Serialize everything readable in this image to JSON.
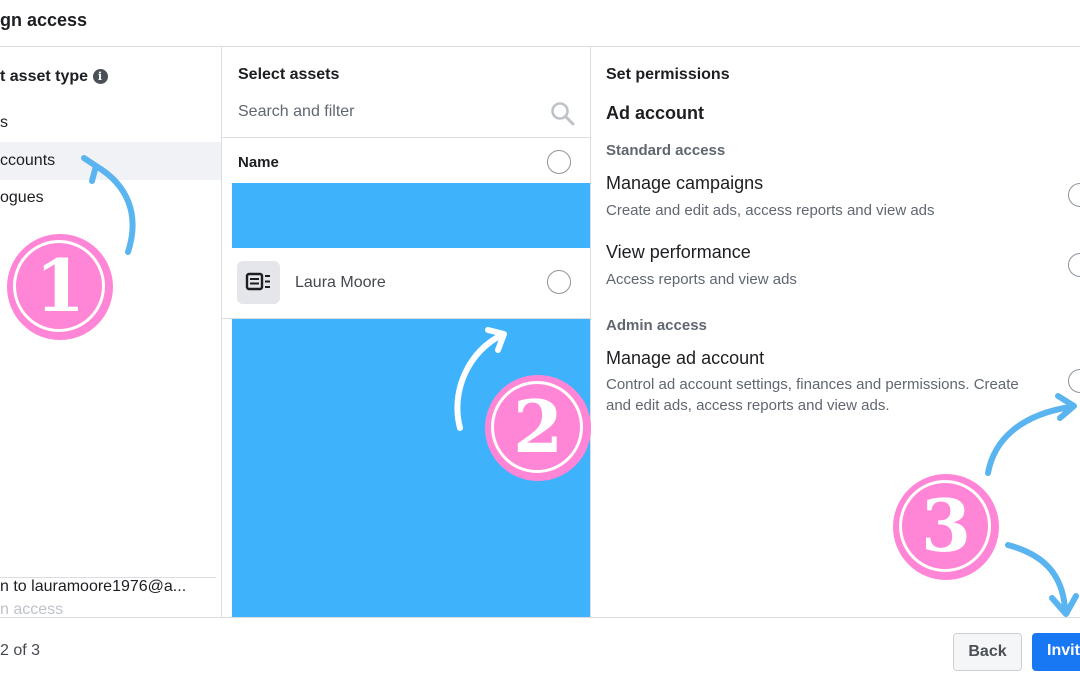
{
  "dialog": {
    "title": "gn access"
  },
  "asset_types": {
    "heading": "t asset type",
    "info_icon": "info-icon",
    "items": [
      {
        "label": "s"
      },
      {
        "label": "ccounts"
      },
      {
        "label": "ogues"
      }
    ],
    "share_text": "n to lauramoore1976@a...",
    "share_subtext": "n access"
  },
  "assets": {
    "heading": "Select assets",
    "search_placeholder": "Search and filter",
    "column_name": "Name",
    "rows": [
      {
        "label": "Laura Moore",
        "icon": "ad-account-icon"
      }
    ]
  },
  "permissions": {
    "heading": "Set permissions",
    "section_title": "Ad account",
    "groups": [
      {
        "label": "Standard access",
        "options": [
          {
            "title": "Manage campaigns",
            "description": "Create and edit ads, access reports and view ads"
          },
          {
            "title": "View performance",
            "description": "Access reports and view ads"
          }
        ]
      },
      {
        "label": "Admin access",
        "options": [
          {
            "title": "Manage ad account",
            "description_line1": "Control ad account settings, finances and permissions. Create",
            "description_line2": "and edit ads, access reports and view ads."
          }
        ]
      }
    ]
  },
  "footer": {
    "step_text": "2 of 3",
    "back_label": "Back",
    "invite_label": "Invit"
  },
  "annotations": {
    "badge_1": "1",
    "badge_2": "2",
    "badge_3": "3"
  },
  "colors": {
    "overlay_blue": "#3eb3fb",
    "badge_pink": "#ff86d6",
    "arrow_blue": "#5ab4f0",
    "primary_button": "#1877f2"
  }
}
